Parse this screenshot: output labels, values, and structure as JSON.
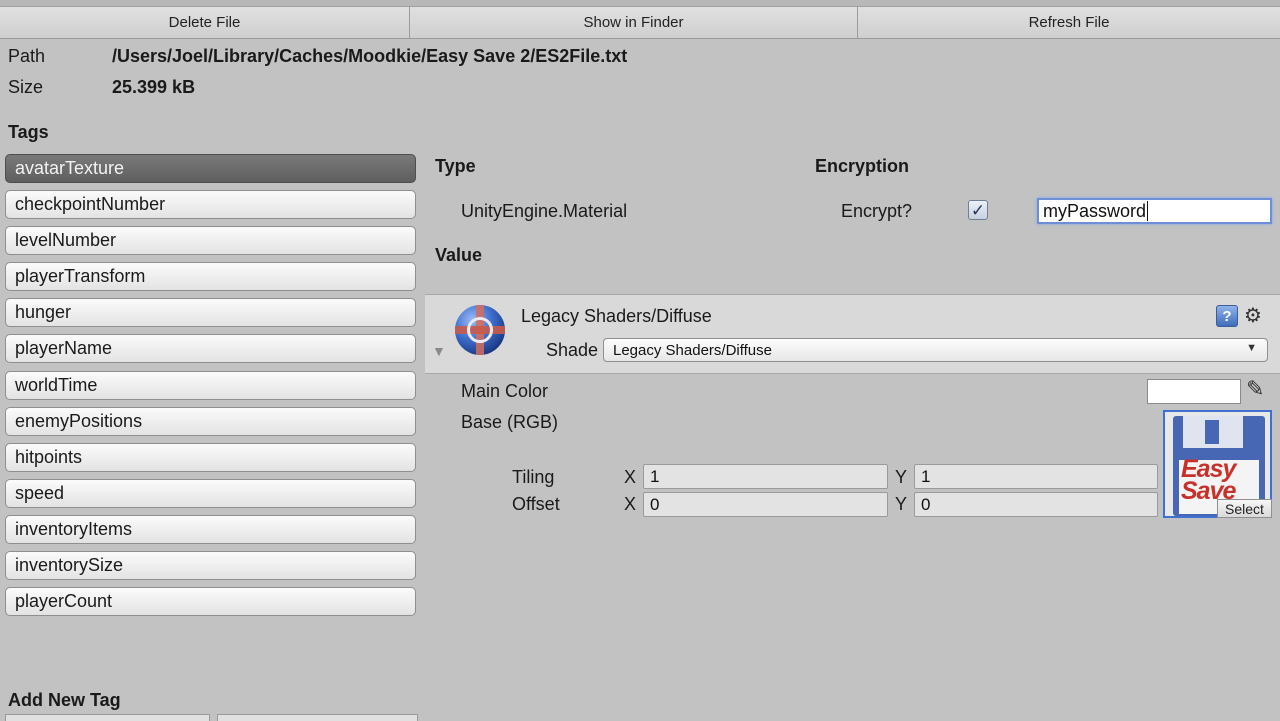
{
  "toolbar": {
    "delete_label": "Delete File",
    "show_label": "Show in Finder",
    "refresh_label": "Refresh File"
  },
  "file": {
    "path_label": "Path",
    "path_value": "/Users/Joel/Library/Caches/Moodkie/Easy Save 2/ES2File.txt",
    "size_label": "Size",
    "size_value": "25.399 kB"
  },
  "tags": {
    "heading": "Tags",
    "selected_index": 0,
    "items": [
      "avatarTexture",
      "checkpointNumber",
      "levelNumber",
      "playerTransform",
      "hunger",
      "playerName",
      "worldTime",
      "enemyPositions",
      "hitpoints",
      "speed",
      "inventoryItems",
      "inventorySize",
      "playerCount"
    ],
    "add_heading": "Add New Tag"
  },
  "details": {
    "type_heading": "Type",
    "type_value": "UnityEngine.Material",
    "encryption_heading": "Encryption",
    "encrypt_label": "Encrypt?",
    "encrypt_checked": true,
    "password_value": "myPassword",
    "value_heading": "Value"
  },
  "material": {
    "name": "Legacy Shaders/Diffuse",
    "shader_label": "Shade",
    "shader_value": "Legacy Shaders/Diffuse",
    "main_color_label": "Main Color",
    "main_color_value": "#ffffff",
    "base_label": "Base (RGB)",
    "tiling_label": "Tiling",
    "offset_label": "Offset",
    "x_label": "X",
    "y_label": "Y",
    "tiling_x": "1",
    "tiling_y": "1",
    "offset_x": "0",
    "offset_y": "0",
    "texture_logo_line1": "Easy",
    "texture_logo_line2": "Save",
    "select_label": "Select"
  },
  "icons": {
    "help": "help-icon",
    "gear": "gear-icon",
    "picker": "eyedropper-icon",
    "fold": "foldout-arrow-icon",
    "check": "checkmark-icon"
  }
}
